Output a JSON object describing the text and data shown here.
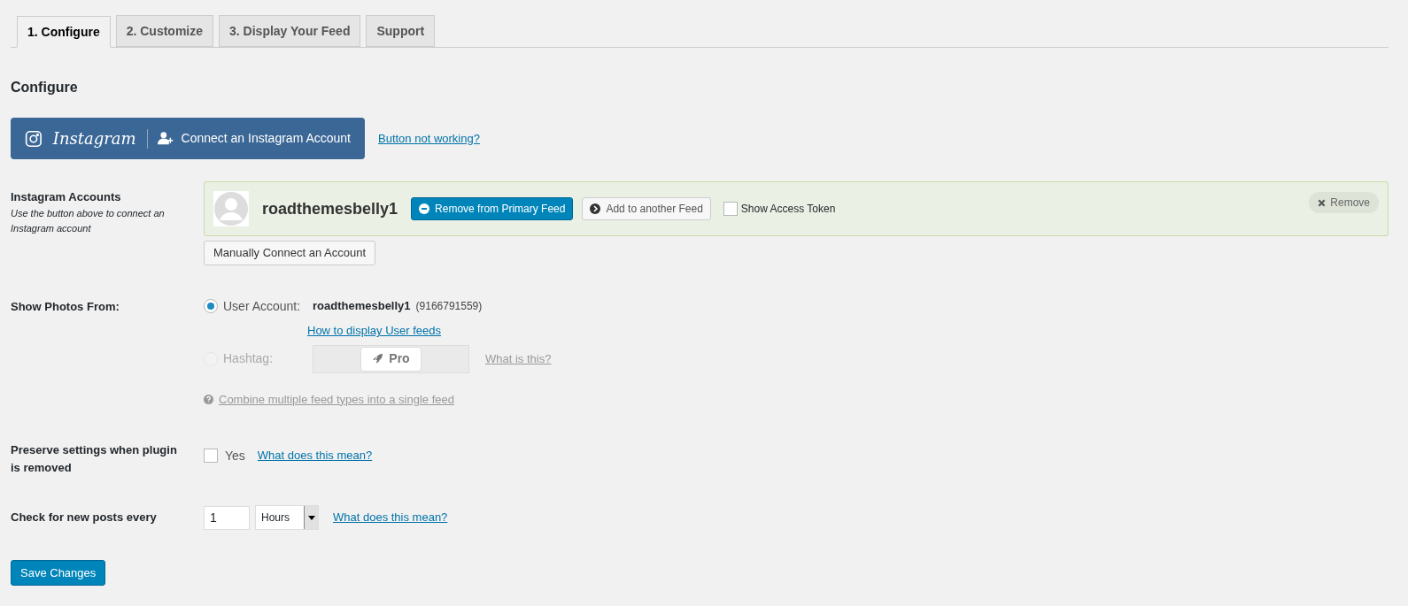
{
  "tabs": [
    {
      "label": "1. Configure",
      "selected": true
    },
    {
      "label": "2. Customize",
      "selected": false
    },
    {
      "label": "3. Display Your Feed",
      "selected": false
    },
    {
      "label": "Support",
      "selected": false
    }
  ],
  "heading": "Configure",
  "connect": {
    "logo_text": "Instagram",
    "label": "Connect an Instagram Account",
    "help_link": "Button not working?"
  },
  "accounts": {
    "label": "Instagram Accounts",
    "description": "Use the button above to connect an Instagram account",
    "items": [
      {
        "username": "roadthemesbelly1",
        "primary_button": "Remove from Primary Feed",
        "add_button": "Add to another Feed",
        "token_label": "Show Access Token",
        "token_checked": false,
        "remove_button": "Remove"
      }
    ],
    "manual_button": "Manually Connect an Account"
  },
  "show_photos": {
    "label": "Show Photos From:",
    "options": [
      {
        "kind": "user",
        "label": "User Account:",
        "selected": true,
        "disabled": false,
        "username": "roadthemesbelly1",
        "account_id": "(9166791559)",
        "link": "How to display User feeds"
      },
      {
        "kind": "hashtag",
        "label": "Hashtag:",
        "selected": false,
        "disabled": true,
        "pro_label": "Pro",
        "link": "What is this?"
      }
    ],
    "combine_link": "Combine multiple feed types into a single feed"
  },
  "preserve": {
    "label": "Preserve settings when plugin is removed",
    "checkbox_label": "Yes",
    "checked": false,
    "link": "What does this mean?"
  },
  "check_posts": {
    "label": "Check for new posts every",
    "value": "1",
    "unit": "Hours",
    "link": "What does this mean?"
  },
  "save_button": "Save Changes"
}
